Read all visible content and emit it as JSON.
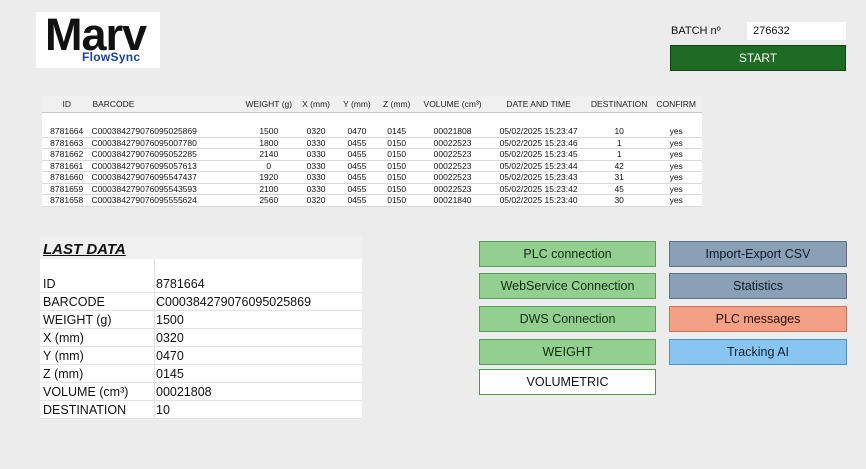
{
  "logo": {
    "brand": "Marv",
    "sub": "FlowSync"
  },
  "batch": {
    "label": "BATCH nº",
    "value": "276632"
  },
  "start_button": "START",
  "table": {
    "headers": [
      "ID",
      "BARCODE",
      "WEIGHT (g)",
      "X (mm)",
      "Y (mm)",
      "Z (mm)",
      "VOLUME (cm³)",
      "DATE AND TIME",
      "DESTINATION",
      "CONFIRM"
    ],
    "rows": [
      [
        "8781664",
        "C000384279076095025869",
        "1500",
        "0320",
        "0470",
        "0145",
        "00021808",
        "05/02/2025 15:23:47",
        "10",
        "yes"
      ],
      [
        "8781663",
        "C000384279076095007780",
        "1800",
        "0330",
        "0455",
        "0150",
        "00022523",
        "05/02/2025 15:23:46",
        "1",
        "yes"
      ],
      [
        "8781662",
        "C000384279076095052285",
        "2140",
        "0330",
        "0455",
        "0150",
        "00022523",
        "05/02/2025 15:23:45",
        "1",
        "yes"
      ],
      [
        "8781661",
        "C000384279076095057613",
        "0",
        "0330",
        "0455",
        "0150",
        "00022523",
        "05/02/2025 15:23:44",
        "42",
        "yes"
      ],
      [
        "8781660",
        "C000384279076095547437",
        "1920",
        "0330",
        "0455",
        "0150",
        "00022523",
        "05/02/2025 15:23:43",
        "31",
        "yes"
      ],
      [
        "8781659",
        "C000384279076095543593",
        "2100",
        "0330",
        "0455",
        "0150",
        "00022523",
        "05/02/2025 15:23:42",
        "45",
        "yes"
      ],
      [
        "8781658",
        "C000384279076095555624",
        "2560",
        "0320",
        "0455",
        "0150",
        "00021840",
        "05/02/2025 15:23:40",
        "30",
        "yes"
      ]
    ]
  },
  "last_data": {
    "title": "LAST DATA",
    "fields": [
      {
        "key": "ID",
        "value": "8781664"
      },
      {
        "key": "BARCODE",
        "value": "C000384279076095025869"
      },
      {
        "key": "WEIGHT (g)",
        "value": "1500"
      },
      {
        "key": "X (mm)",
        "value": "0320"
      },
      {
        "key": "Y (mm)",
        "value": "0470"
      },
      {
        "key": "Z (mm)",
        "value": "0145"
      },
      {
        "key": "VOLUME (cm³)",
        "value": "00021808"
      },
      {
        "key": "DESTINATION",
        "value": "10"
      }
    ]
  },
  "buttons": {
    "plc_connection": "PLC connection",
    "webservice_connection": "WebService Connection",
    "dws_connection": "DWS Connection",
    "weight": "WEIGHT",
    "volumetric": "VOLUMETRIC",
    "import_export_csv": "Import-Export  CSV",
    "statistics": "Statistics",
    "plc_messages": "PLC messages",
    "tracking_ai": "Tracking AI"
  },
  "colors": {
    "start": "#1e6b23",
    "status_green": "#93cf91",
    "slate": "#8aa0b6",
    "salmon": "#f4a085",
    "blue": "#88c6f1"
  }
}
